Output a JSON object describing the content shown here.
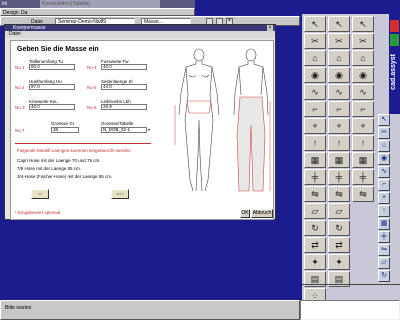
{
  "app": {
    "title_bar_text": "Ini",
    "window_title": "Konstruktion [Tabelle]",
    "menu": [
      "Design",
      "Da"
    ],
    "toolbar": {
      "date_label": "Datei",
      "file_name": "Seminar-Demo-Nw89",
      "dropdown_value": "Masse..."
    },
    "status_text": "Bitte warten"
  },
  "dialog": {
    "title": "Koerpermasse",
    "menu_item": "Datei",
    "heading": "Geben Sie die Masse ein",
    "fields": [
      {
        "no": "No 1",
        "label": "Taillenumfang Tu",
        "value": "80.0"
      },
      {
        "no": "No 2",
        "label": "Hueftumfang Hu",
        "value": "97.0"
      },
      {
        "no": "No 3",
        "label": "Knieweite Kw...",
        "value": "40.0"
      },
      {
        "no": "No 4",
        "label": "Fussweite Fw",
        "value": "40.0"
      },
      {
        "no": "No 5",
        "label": "Seitenlaenge Sl",
        "value": "44.0"
      },
      {
        "no": "No 6",
        "label": "Leibhoehe Lbh",
        "value": "26.9"
      },
      {
        "no": "No 7",
        "label": "Groesse Gr",
        "value": "38"
      },
      {
        "no": "No 8",
        "label": "Groesse/Tabelle",
        "value": "N_DOB_32-1"
      }
    ],
    "warning": "Folgende Modell-Laengen koennen eingetauscht werden",
    "info_lines": [
      "Capri Hose mit der Laenge 70 und 75 cm.",
      "7/8 Hose mit der Laenge 85 cm.",
      "3/4-Hose (Fischer-Hose) mit der Laenge 55 cm."
    ],
    "option_buttons": [
      "ok",
      "abbr"
    ],
    "footnote": "* Eingabewert optional",
    "ok_label": "OK",
    "cancel_label": "Abbruch"
  },
  "brand": {
    "name": "cad.assyst",
    "accent": "#1c1c8e",
    "tab_colors": [
      "#d23030",
      "#2a9a3a"
    ]
  },
  "tool_icons_col1": [
    "arrow-icon",
    "cut-icon",
    "shirt-icon",
    "eye-icon",
    "curve-icon",
    "fold-icon",
    "plus-icon",
    "arrow-up-icon",
    "pattern-icon",
    "seam-icon",
    "mirror-icon",
    "piece-icon",
    "rotate-icon",
    "flip-icon",
    "star-icon",
    "grid-icon",
    "dots-icon"
  ],
  "tool_icons_col2": [
    "square-icon",
    "diag-icon",
    "square2-icon",
    "pencil-icon",
    "bracket-icon",
    "ruler-icon",
    "measure-icon",
    "cross-icon",
    "ruler2-icon",
    "notch-icon",
    "shape-icon",
    "cut2-icon",
    "join-icon",
    "split-icon",
    "hat-icon",
    "drill-icon"
  ],
  "tool_icons_col3": [
    "fx-icon",
    "tri-icon",
    "link-icon",
    "square3-icon",
    "grid2-icon",
    "label-icon",
    "circle-icon",
    "marker-icon",
    "num-icon",
    "select-icon",
    "pattern2-icon",
    "stamp-icon",
    "gear-icon"
  ]
}
